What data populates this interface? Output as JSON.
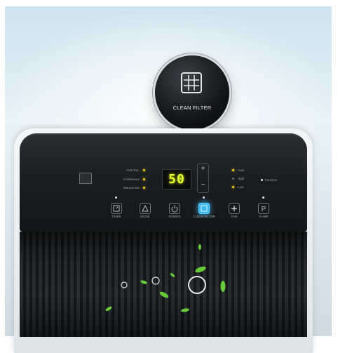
{
  "badge": {
    "label": "CLEAN FILTER",
    "icon": "filter-grid-icon"
  },
  "left_indicators": [
    {
      "label": "Auto Dry",
      "state": "on"
    },
    {
      "label": "Continuous",
      "state": "on"
    },
    {
      "label": "Manual Set",
      "state": "on"
    }
  ],
  "display": {
    "value": "50"
  },
  "stepper": {
    "plus": "+",
    "minus": "−"
  },
  "right_indicators": [
    {
      "label": "Auto",
      "state": "on"
    },
    {
      "label": "High",
      "state": "off"
    },
    {
      "label": "Low",
      "state": "on"
    }
  ],
  "extra_indicator": {
    "label": "Function"
  },
  "buttons": [
    {
      "label": "TIMER",
      "icon": "timer-icon"
    },
    {
      "label": "MODE",
      "icon": "mode-triangle-icon"
    },
    {
      "label": "POWER",
      "icon": "power-icon"
    },
    {
      "label": "CLEAN FILTER",
      "icon": "clean-filter-icon"
    },
    {
      "label": "FAN",
      "icon": "fan-icon"
    },
    {
      "label": "PUMP",
      "icon": "pump-p-icon"
    }
  ],
  "colors": {
    "display": "#e7ff33",
    "highlight": "#3cb8ee",
    "indicator_on": "#ffd21f",
    "leaf": "#6ad33a"
  }
}
